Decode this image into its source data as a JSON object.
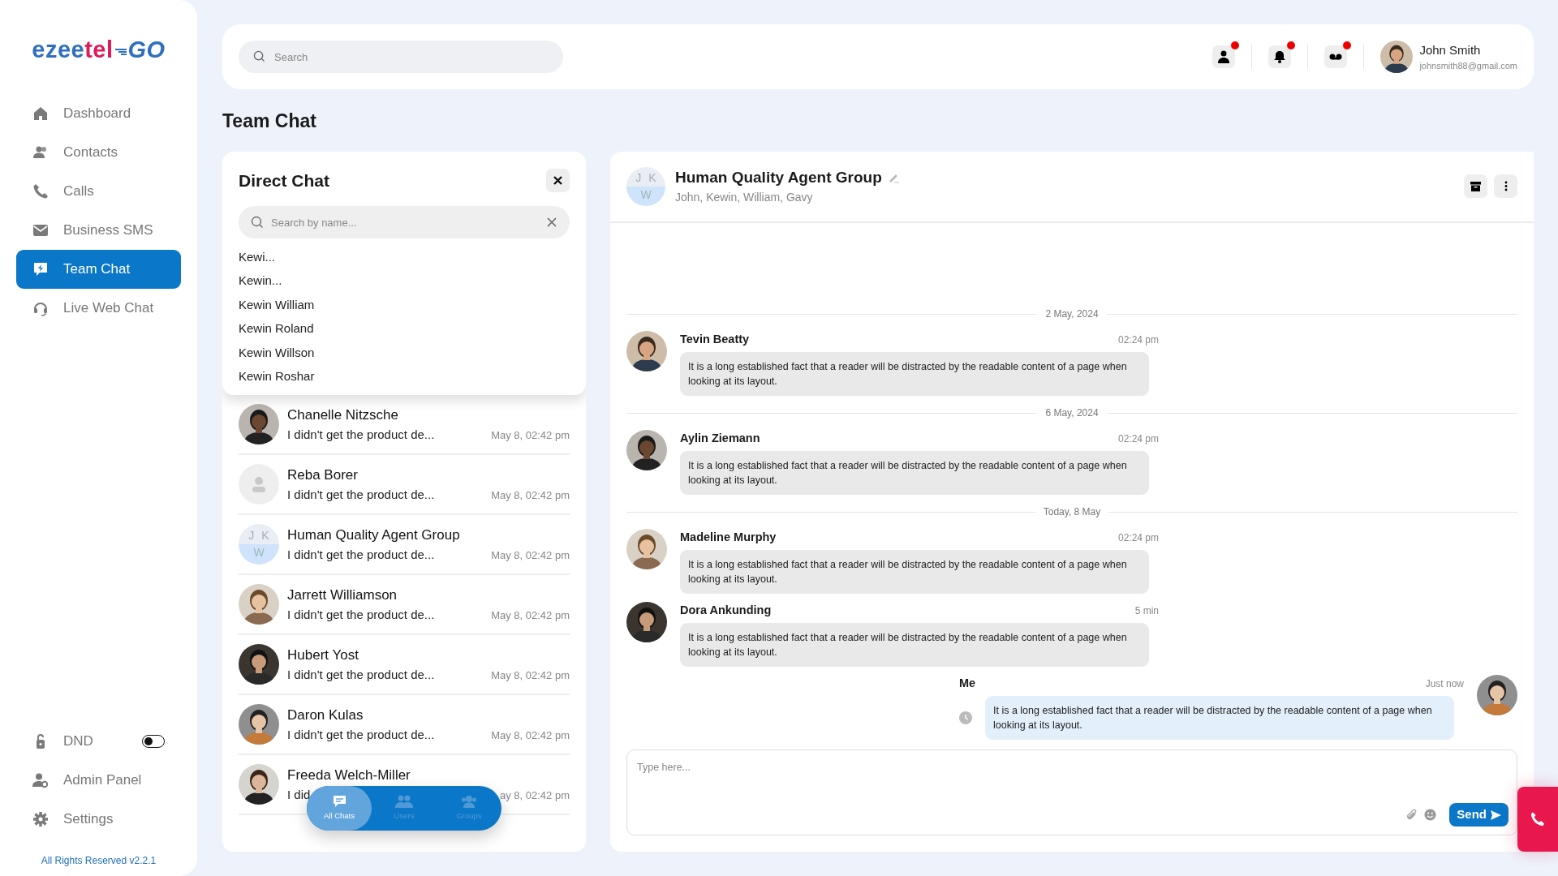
{
  "logo": {
    "first": "ezee",
    "second": "tel",
    "third": "GO"
  },
  "sidebar": {
    "items": [
      {
        "label": "Dashboard",
        "selected": false
      },
      {
        "label": "Contacts",
        "selected": false
      },
      {
        "label": "Calls",
        "selected": false
      },
      {
        "label": "Business SMS",
        "selected": false
      },
      {
        "label": "Team Chat",
        "selected": true
      },
      {
        "label": "Live Web Chat",
        "selected": false
      }
    ],
    "bottom_items": [
      {
        "label": "DND",
        "kind": "toggle",
        "on": false
      },
      {
        "label": "Admin Panel",
        "kind": "link"
      },
      {
        "label": "Settings",
        "kind": "link"
      }
    ],
    "footer": "All Rights Reserved v2.2.1"
  },
  "topbar": {
    "search": {
      "placeholder": "Search"
    },
    "user": {
      "name": "John Smith",
      "email": "johnsmith88@gmail.com"
    }
  },
  "page_title": "Team Chat",
  "direct_chat": {
    "title": "Direct Chat",
    "search": {
      "placeholder": "Search by name..."
    },
    "suggestions": [
      "Kewi...",
      "Kewin...",
      "Kewin William",
      "Kewin Roland",
      "Kewin Willson",
      "Kewin Roshar"
    ],
    "chats": [
      {
        "name": "Chanelle Nitzsche",
        "preview": "I didn't get the product de...",
        "time": "May 8, 02:42 pm"
      },
      {
        "name": "Reba Borer",
        "preview": "I didn't get the product de...",
        "time": "May 8, 02:42 pm",
        "kind": "placeholder"
      },
      {
        "name": "Human Quality Agent Group",
        "preview": "I didn't get the product de...",
        "time": "May 8, 02:42 pm",
        "kind": "initials",
        "initials": [
          "J",
          "K",
          "W"
        ]
      },
      {
        "name": "Jarrett Williamson",
        "preview": "I didn't get the product de...",
        "time": "May 8, 02:42 pm"
      },
      {
        "name": "Hubert Yost",
        "preview": "I didn't get the product de...",
        "time": "May 8, 02:42 pm"
      },
      {
        "name": "Daron Kulas",
        "preview": "I didn't get the product de...",
        "time": "May 8, 02:42 pm"
      },
      {
        "name": "Freeda Welch-Miller",
        "preview": "I did",
        "time": "ay 8, 02:42 pm"
      }
    ],
    "nav_tabs": [
      {
        "label": "All Chats",
        "selected": true
      },
      {
        "label": "Users",
        "selected": false
      },
      {
        "label": "Groups",
        "selected": false
      }
    ]
  },
  "conversation": {
    "title": "Human Quality Agent Group",
    "members": "John, Kewin, William, Gavy",
    "initials": [
      "J",
      "K",
      "W"
    ],
    "messages": [
      {
        "kind": "date",
        "text": "2 May, 2024"
      },
      {
        "kind": "incoming",
        "sender": "Tevin Beatty",
        "time": "02:24 pm",
        "text": "It is a long established fact that a reader will be distracted by the readable content of a page when looking at its layout."
      },
      {
        "kind": "date",
        "text": "6 May, 2024"
      },
      {
        "kind": "incoming",
        "sender": "Aylin Ziemann",
        "time": "02:24 pm",
        "text": "It is a long established fact that a reader will be distracted by the readable content of a page when looking at its layout."
      },
      {
        "kind": "date",
        "text": "Today, 8 May"
      },
      {
        "kind": "incoming",
        "sender": "Madeline Murphy",
        "time": "02:24 pm",
        "text": "It is a long established fact that a reader will be distracted by the readable content of a page when looking at its layout."
      },
      {
        "kind": "incoming",
        "sender": "Dora Ankunding",
        "time": "5 min",
        "text": "It is a long established fact that a reader will be distracted by the readable content of a page when looking at its layout."
      },
      {
        "kind": "outgoing",
        "sender": "Me",
        "time": "Just now",
        "text": "It is a long established fact that a reader will be distracted by the readable content of a page when looking at its layout."
      }
    ],
    "compose": {
      "placeholder": "Type here...",
      "send": "Send"
    }
  }
}
